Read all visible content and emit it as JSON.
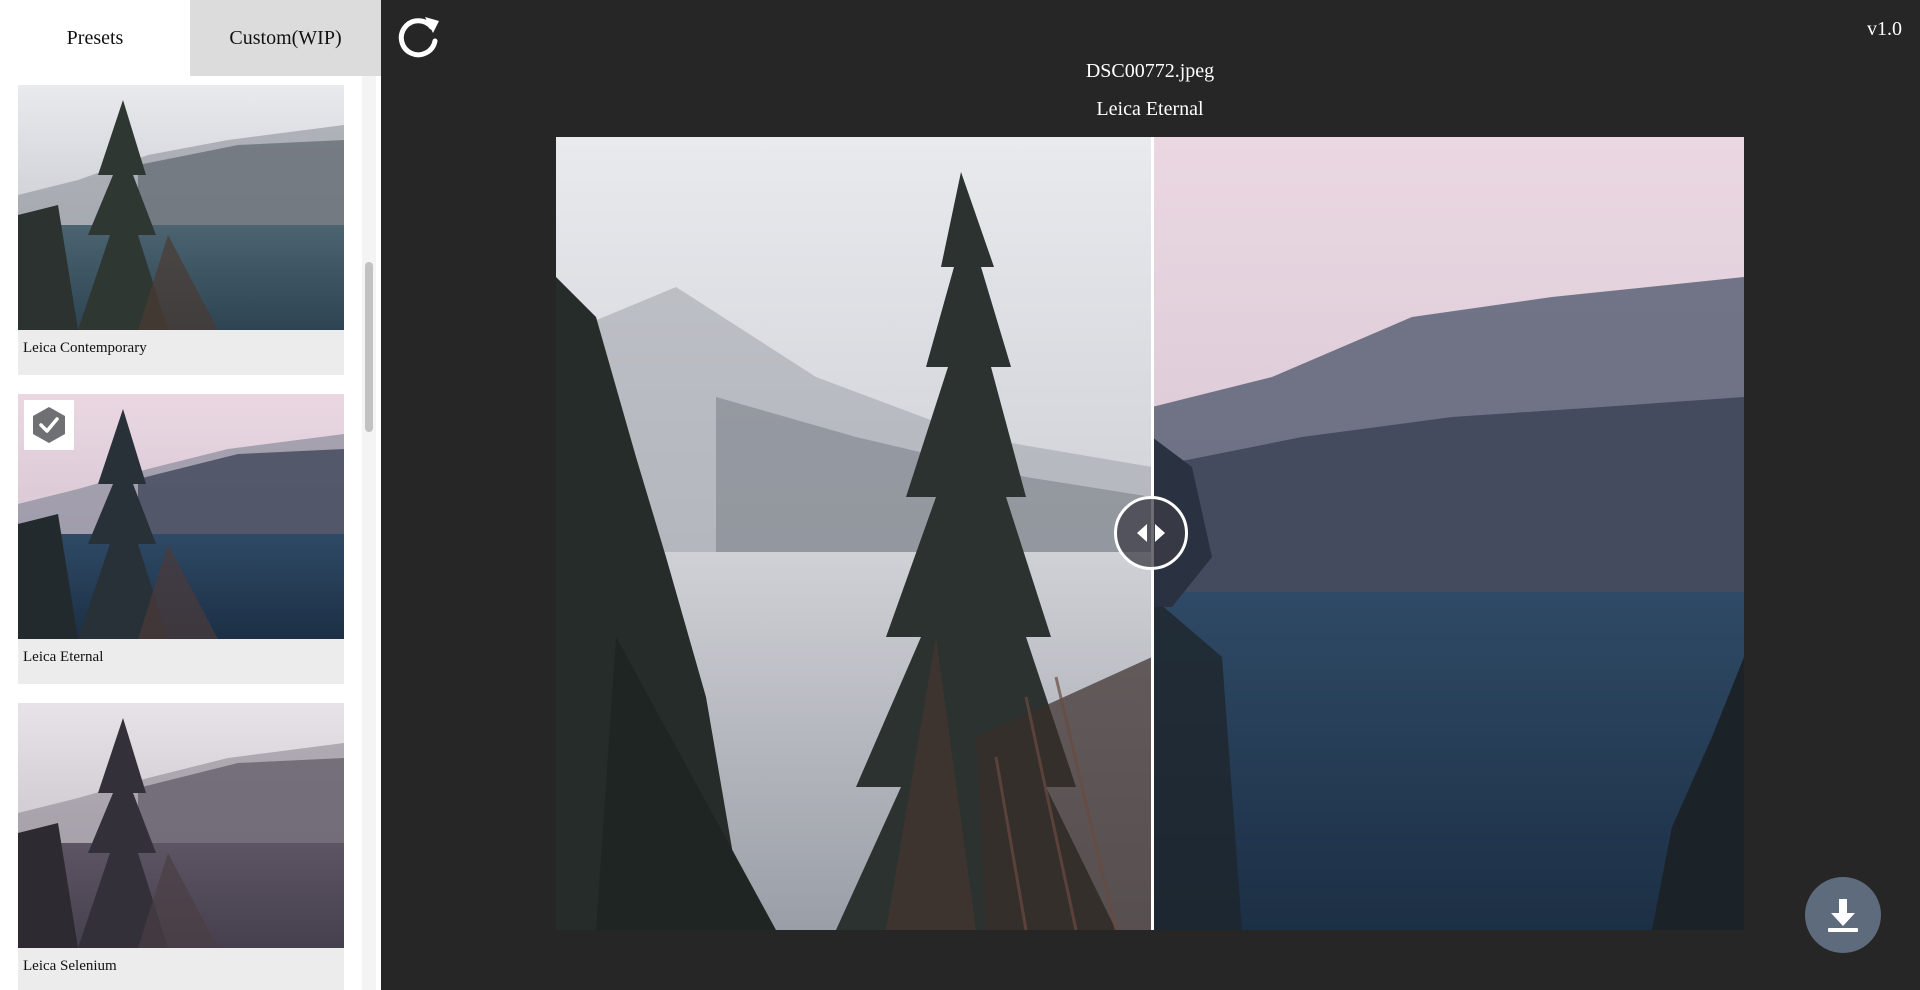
{
  "sidebar": {
    "tabs": [
      {
        "label": "Presets",
        "active": true
      },
      {
        "label": "Custom(WIP)",
        "active": false
      }
    ],
    "presets": [
      {
        "label": "Leica Contemporary",
        "selected": false
      },
      {
        "label": "Leica Eternal",
        "selected": true
      },
      {
        "label": "Leica Selenium",
        "selected": false
      }
    ]
  },
  "header": {
    "version": "v1.0",
    "filename": "DSC00772.jpeg",
    "current_preset": "Leica Eternal"
  },
  "icons": {
    "refresh": "refresh-icon",
    "check": "check-icon",
    "compare_handle": "compare-arrows-icon",
    "download": "download-icon"
  },
  "colors": {
    "background": "#262626",
    "sidebar": "#ffffff",
    "inactive_tab": "#dcdcdc",
    "download_button": "#5d6b7c"
  }
}
